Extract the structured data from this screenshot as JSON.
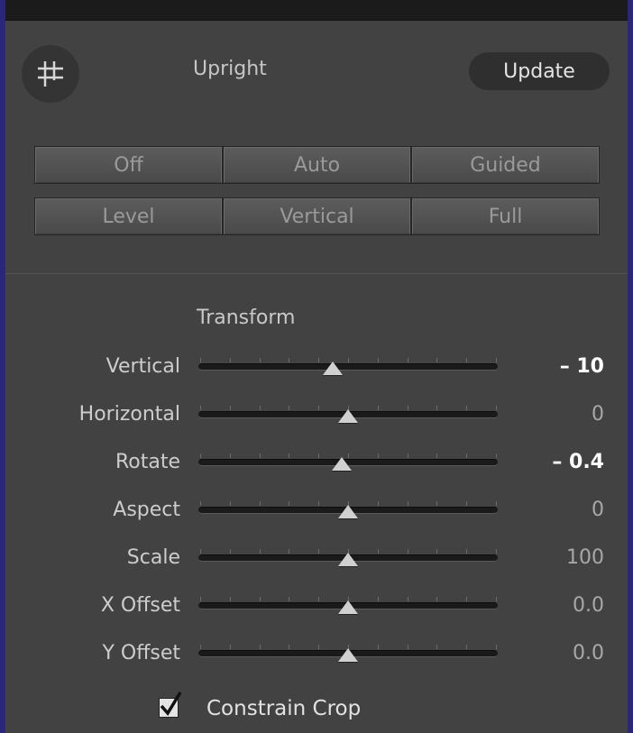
{
  "panel": {
    "crop_icon": "crop-grid-icon",
    "upright_label": "Upright",
    "update_label": "Update"
  },
  "modes": {
    "row1": [
      "Off",
      "Auto",
      "Guided"
    ],
    "row2": [
      "Level",
      "Vertical",
      "Full"
    ]
  },
  "transform": {
    "title": "Transform",
    "sliders": [
      {
        "label": "Vertical",
        "value": "– 10",
        "position": 0.45,
        "emphasized": true
      },
      {
        "label": "Horizontal",
        "value": "0",
        "position": 0.5,
        "emphasized": false
      },
      {
        "label": "Rotate",
        "value": "– 0.4",
        "position": 0.48,
        "emphasized": true
      },
      {
        "label": "Aspect",
        "value": "0",
        "position": 0.5,
        "emphasized": false
      },
      {
        "label": "Scale",
        "value": "100",
        "position": 0.5,
        "emphasized": false
      },
      {
        "label": "X Offset",
        "value": "0.0",
        "position": 0.5,
        "emphasized": false
      },
      {
        "label": "Y Offset",
        "value": "0.0",
        "position": 0.5,
        "emphasized": false
      }
    ]
  },
  "constrain_crop": {
    "label": "Constrain Crop",
    "checked": true
  },
  "colors": {
    "frame": "#2a2779",
    "panel": "#424242",
    "value_emphasized": "#ffffff",
    "value_normal": "#a8a8a8"
  }
}
